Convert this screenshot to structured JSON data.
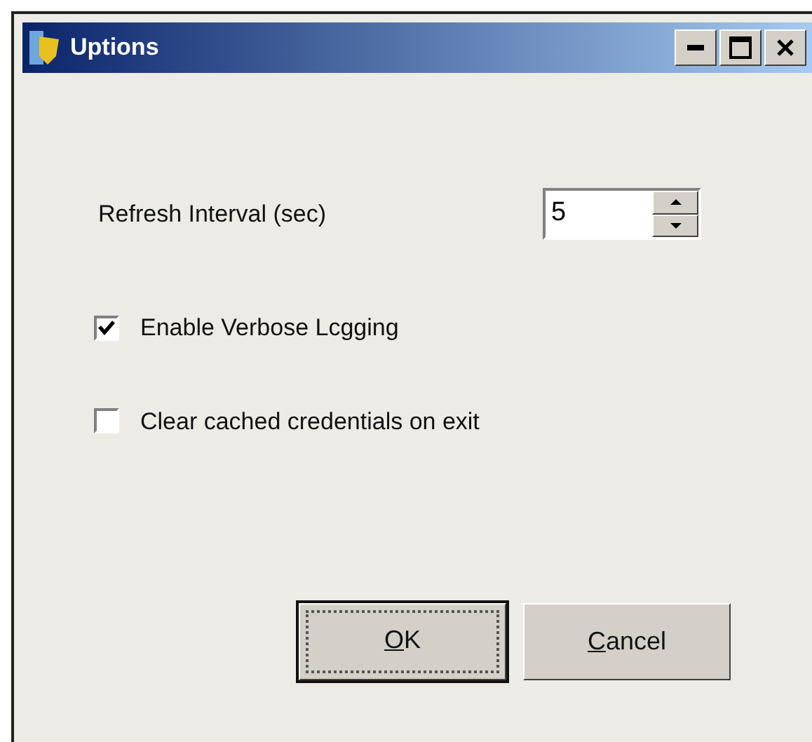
{
  "window": {
    "title": "Uptions"
  },
  "refresh_interval": {
    "label": "Refresh Interval (sec)",
    "value": "5"
  },
  "checkboxes": [
    {
      "label": "Enable Verbose Lcgging",
      "checked": true
    },
    {
      "label": "Clear cached credentials on exit",
      "checked": false
    }
  ],
  "buttons": [
    {
      "label": "OK",
      "underlined_first_letter": true,
      "default": true
    },
    {
      "label": "Cancel",
      "underlined_first_letter": true,
      "default": false
    }
  ]
}
